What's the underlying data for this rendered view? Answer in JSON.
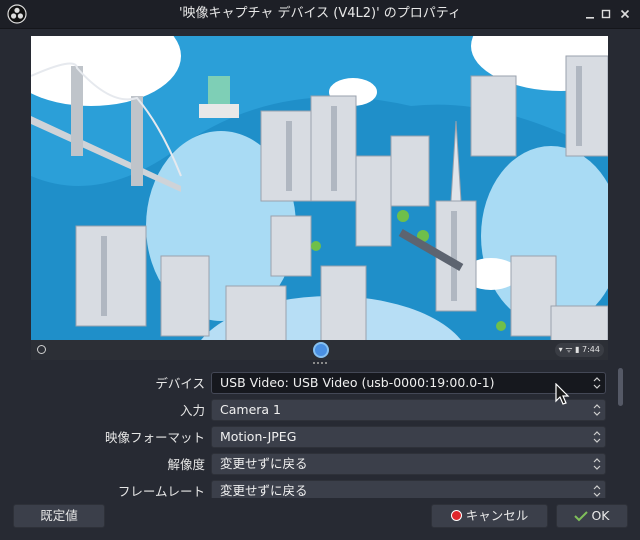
{
  "window": {
    "title": "'映像キャプチャ デバイス (V4L2)' のプロパティ",
    "icons": [
      "obs-logo-icon",
      "minimize-icon",
      "maximize-icon",
      "close-icon"
    ]
  },
  "preview": {
    "taskbar": {
      "status_text": "▾ ᯤ ▮ 7:44"
    }
  },
  "properties": [
    {
      "label": "デバイス",
      "value": "USB Video: USB Video (usb-0000:19:00.0-1)"
    },
    {
      "label": "入力",
      "value": "Camera 1"
    },
    {
      "label": "映像フォーマット",
      "value": "Motion-JPEG"
    },
    {
      "label": "解像度",
      "value": "変更せずに戻る"
    },
    {
      "label": "フレームレート",
      "value": "変更せずに戻る"
    }
  ],
  "buttons": {
    "defaults": "既定値",
    "cancel": "キャンセル",
    "ok": "OK"
  },
  "colors": {
    "background": "#272a33",
    "titlebar": "#1d1f26",
    "combo": "#3b3f4a",
    "combo_active": "#16181e",
    "cancel_icon": "#e0262b",
    "preview_sky": "#1f8fc9"
  }
}
